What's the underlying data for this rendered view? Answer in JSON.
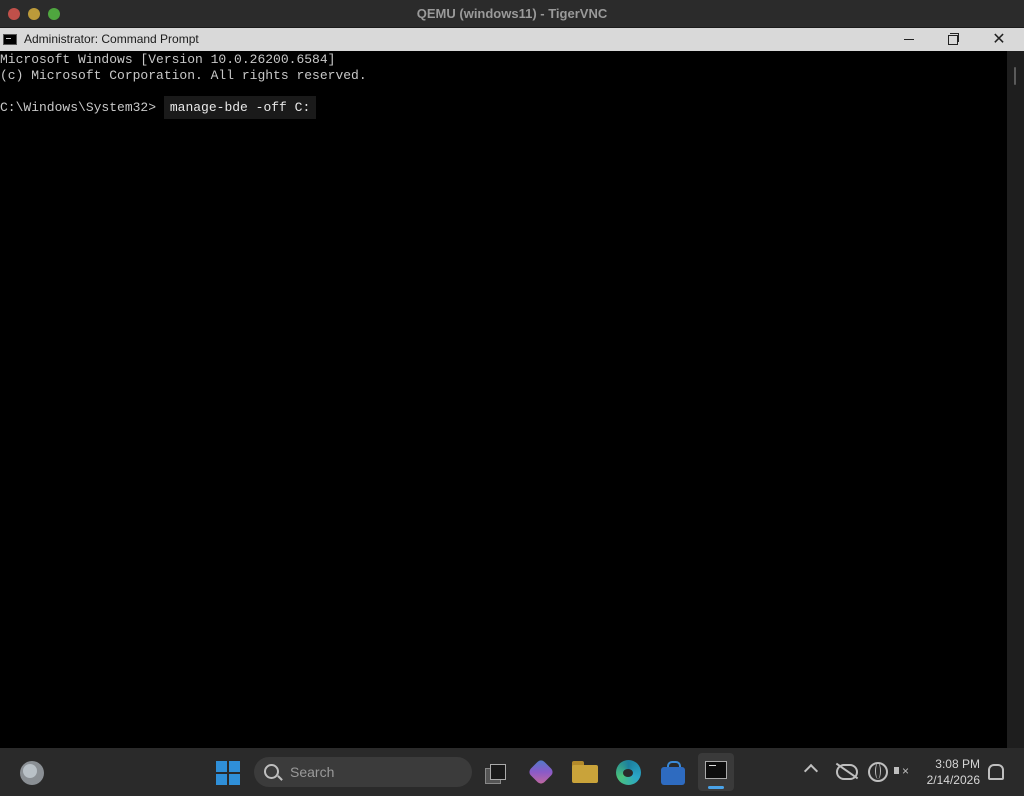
{
  "vnc": {
    "window_title": "QEMU (windows11) - TigerVNC"
  },
  "console_window": {
    "title": "Administrator: Command Prompt",
    "lines": [
      "Microsoft Windows [Version 10.0.26200.6584]",
      "(c) Microsoft Corporation. All rights reserved."
    ],
    "prompt": "C:\\Windows\\System32>",
    "command": "manage-bde -off C:"
  },
  "taskbar": {
    "search_placeholder": "Search",
    "apps": [
      "widgets-icon",
      "start-icon",
      "task-view-icon",
      "copilot-icon",
      "file-explorer-icon",
      "edge-icon",
      "store-icon",
      "command-prompt-icon"
    ],
    "clock": {
      "time": "3:08 PM",
      "date": "2/14/2026"
    }
  }
}
